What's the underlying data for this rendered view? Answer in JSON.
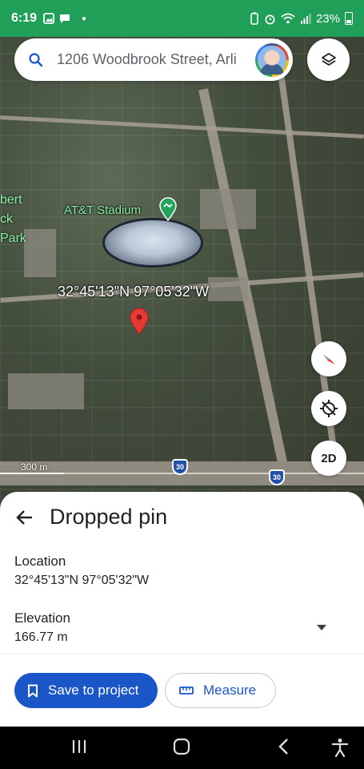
{
  "status_bar": {
    "time": "6:19",
    "battery": "23%",
    "accent": "#1f9f57"
  },
  "search": {
    "query": "1206 Woodbrook Street, Arli",
    "icon": "search-icon"
  },
  "map": {
    "place_label": "AT&T Stadium",
    "park_label_lines": [
      "bert",
      "ck",
      "Park"
    ],
    "coordinates_label": "32°45'13\"N 97°05'32\"W",
    "scale": "300 m",
    "route_shield": "30",
    "view_mode_button": "2D"
  },
  "sheet": {
    "title": "Dropped pin",
    "location_label": "Location",
    "location_value": "32°45'13\"N 97°05'32\"W",
    "elevation_label": "Elevation",
    "elevation_value": "166.77 m",
    "save_label": "Save to project",
    "measure_label": "Measure",
    "primary_color": "#1a56c8"
  }
}
